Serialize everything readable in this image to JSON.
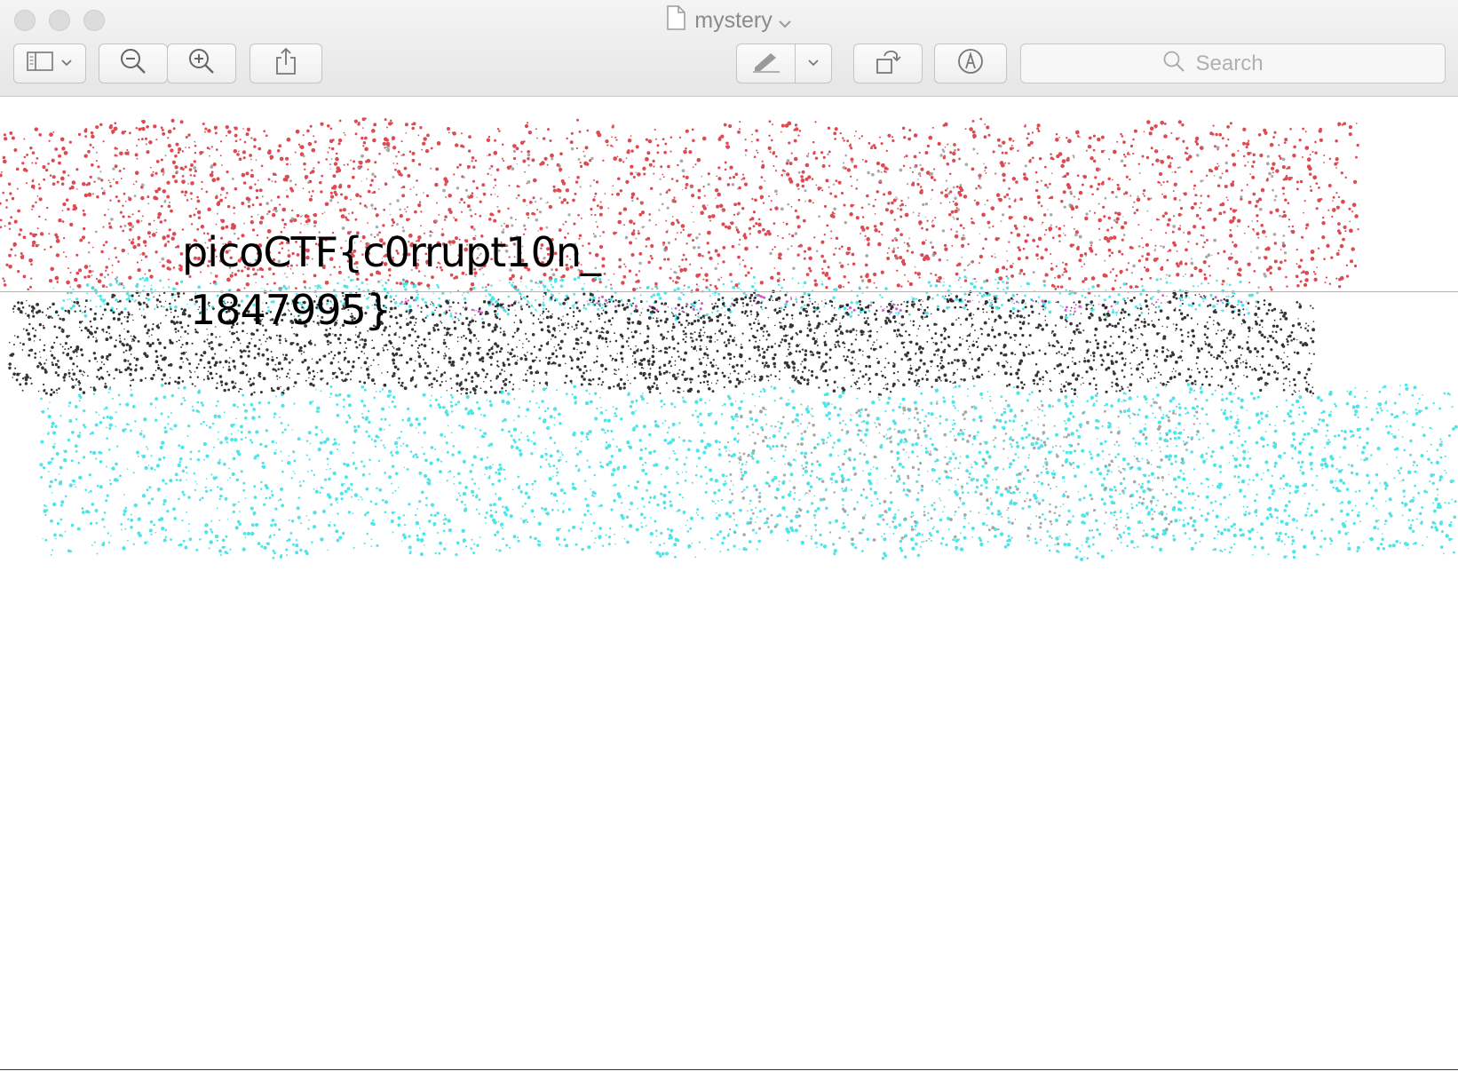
{
  "window": {
    "title": "mystery"
  },
  "toolbar": {
    "buttons": [
      {
        "name": "sidebar-toggle",
        "icon": "sidebar-icon"
      },
      {
        "name": "zoom-out",
        "icon": "zoom-out-icon"
      },
      {
        "name": "zoom-in",
        "icon": "zoom-in-icon"
      },
      {
        "name": "share",
        "icon": "share-icon"
      },
      {
        "name": "markup-pen",
        "icon": "pen-icon"
      },
      {
        "name": "rotate",
        "icon": "rotate-icon"
      },
      {
        "name": "annotate",
        "icon": "markup-icon"
      }
    ],
    "search_placeholder": "Search"
  },
  "document": {
    "flag_line_1": "picoCTF{c0rrupt10n_",
    "flag_line_2": "1847995}",
    "scribble_colors": [
      "#d62b35",
      "#30e0e4",
      "#111111",
      "#9a9a9a",
      "#c040c0"
    ]
  }
}
